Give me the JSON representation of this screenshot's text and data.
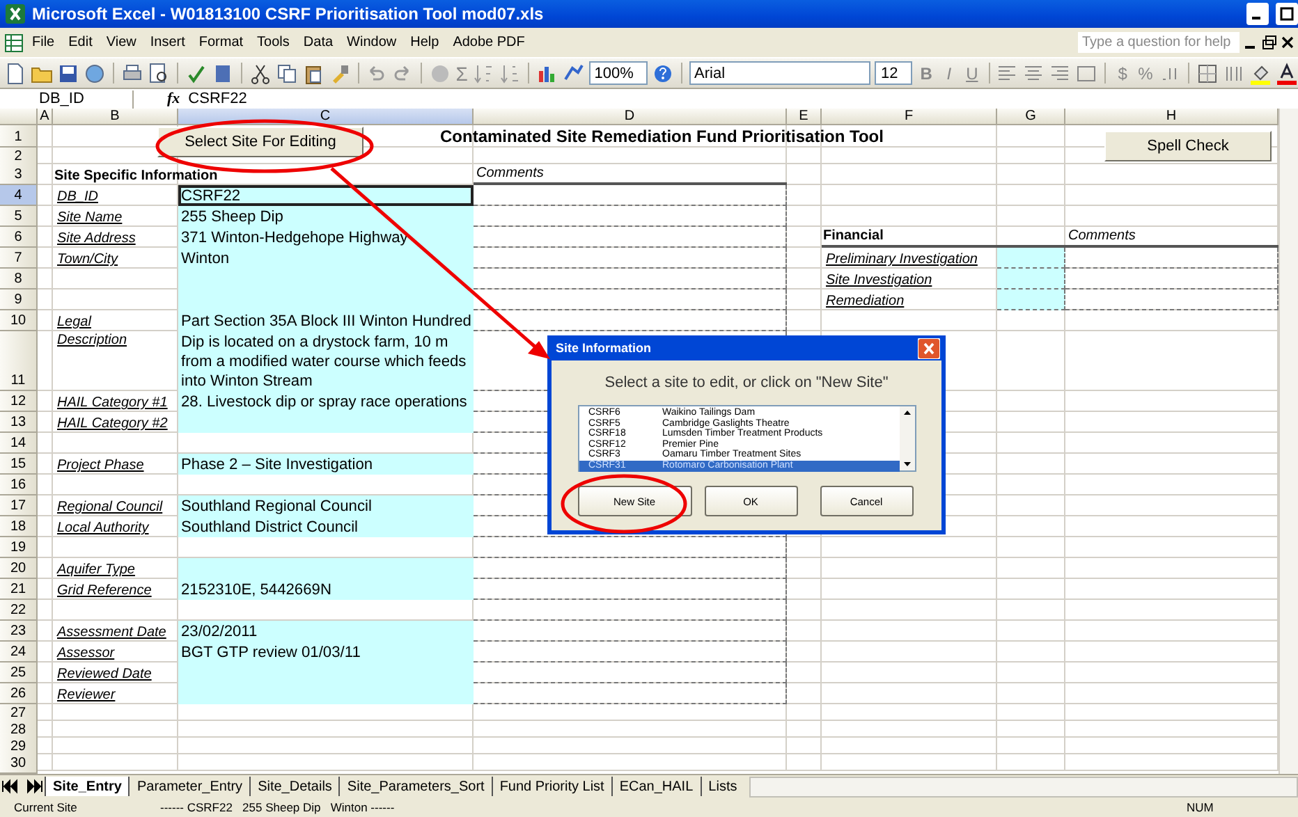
{
  "window": {
    "title": "Microsoft Excel - W01813100 CSRF Prioritisation Tool mod07.xls"
  },
  "menu": {
    "items": [
      "File",
      "Edit",
      "View",
      "Insert",
      "Format",
      "Tools",
      "Data",
      "Window",
      "Help",
      "Adobe PDF"
    ],
    "help_box": {
      "placeholder": "Type a question for help"
    }
  },
  "toolbar": {
    "sum": "Σ",
    "zoom": "100%",
    "font": "Arial",
    "size": "12",
    "format_buttons": [
      "B",
      "I",
      "U"
    ],
    "number_buttons": [
      "$",
      "%"
    ]
  },
  "formula_bar": {
    "name_box": "DB_ID",
    "fx": "fx",
    "value": "CSRF22"
  },
  "columns": [
    {
      "label": "A",
      "selected": false
    },
    {
      "label": "B",
      "selected": false
    },
    {
      "label": "C",
      "selected": true
    },
    {
      "label": "D",
      "selected": false
    },
    {
      "label": "E",
      "selected": false
    },
    {
      "label": "F",
      "selected": false
    },
    {
      "label": "G",
      "selected": false
    },
    {
      "label": "H",
      "selected": false
    }
  ],
  "sheet_buttons": {
    "select_site": "Select Site For Editing",
    "spell_check": "Spell Check"
  },
  "rows": [
    {
      "number": "1",
      "kind": "title",
      "title": "Contaminated Site Remediation Fund Prioritisation Tool",
      "selected": false
    },
    {
      "number": "2",
      "kind": "blank",
      "selected": false
    },
    {
      "number": "3",
      "kind": "heading",
      "label": "Site Specific Information",
      "comment": "Comments",
      "selected": false
    },
    {
      "number": "4",
      "kind": "data",
      "label": "DB_ID",
      "value": "CSRF22",
      "input": true,
      "selected": true
    },
    {
      "number": "5",
      "kind": "data",
      "label": "Site Name",
      "value": "255 Sheep Dip",
      "input": true,
      "selected": false
    },
    {
      "number": "6",
      "kind": "data",
      "label": "Site Address",
      "value": "371 Winton-Hedgehope Highway",
      "input": true,
      "selected": false,
      "right": {
        "kind": "heading",
        "label": "Financial",
        "comment": "Comments"
      }
    },
    {
      "number": "7",
      "kind": "data",
      "label": "Town/City",
      "value": "Winton",
      "input": true,
      "selected": false,
      "right": {
        "kind": "data",
        "label": "Preliminary Investigation",
        "input": true
      }
    },
    {
      "number": "8",
      "kind": "data",
      "input": true,
      "selected": false,
      "right": {
        "kind": "data",
        "label": "Site Investigation",
        "input": true
      }
    },
    {
      "number": "9",
      "kind": "data",
      "input": true,
      "selected": false,
      "right": {
        "kind": "data",
        "label": "Remediation",
        "input": true
      }
    },
    {
      "number": "10",
      "kind": "data",
      "label": "Legal",
      "value": "Part Section 35A Block III Winton Hundred",
      "input": true,
      "selected": false
    },
    {
      "number": "11",
      "kind": "data",
      "label": "Description",
      "value": "Dip is located on a drystock farm, 10 m from a modified water course which feeds into Winton Stream",
      "input": true,
      "selected": false
    },
    {
      "number": "12",
      "kind": "data",
      "label": "HAIL Category #1",
      "value": "28. Livestock dip or spray race operations",
      "input": true,
      "selected": false
    },
    {
      "number": "13",
      "kind": "data",
      "label": "HAIL Category #2",
      "input": true,
      "selected": false
    },
    {
      "number": "14",
      "kind": "data",
      "input": false,
      "selected": false
    },
    {
      "number": "15",
      "kind": "data",
      "label": "Project Phase",
      "value": "Phase 2 – Site Investigation",
      "input": true,
      "selected": false
    },
    {
      "number": "16",
      "kind": "data",
      "input": false,
      "selected": false
    },
    {
      "number": "17",
      "kind": "data",
      "label": "Regional Council",
      "value": "Southland Regional Council",
      "input": true,
      "selected": false
    },
    {
      "number": "18",
      "kind": "data",
      "label": "Local Authority",
      "value": "Southland District Council",
      "input": true,
      "selected": false
    },
    {
      "number": "19",
      "kind": "data",
      "input": false,
      "selected": false
    },
    {
      "number": "20",
      "kind": "data",
      "label": "Aquifer Type",
      "input": true,
      "selected": false
    },
    {
      "number": "21",
      "kind": "data",
      "label": "Grid Reference",
      "value": "2152310E, 5442669N",
      "input": true,
      "selected": false
    },
    {
      "number": "22",
      "kind": "data",
      "input": false,
      "selected": false
    },
    {
      "number": "23",
      "kind": "data",
      "label": "Assessment Date",
      "value": "23/02/2011",
      "input": true,
      "selected": false
    },
    {
      "number": "24",
      "kind": "data",
      "label": "Assessor",
      "value": "BGT  GTP review 01/03/11",
      "input": true,
      "selected": false
    },
    {
      "number": "25",
      "kind": "data",
      "label": "Reviewed Date",
      "input": true,
      "selected": false
    },
    {
      "number": "26",
      "kind": "data",
      "label": "Reviewer",
      "input": true,
      "selected": false
    },
    {
      "number": "27",
      "kind": "blank",
      "selected": false
    },
    {
      "number": "28",
      "kind": "blank",
      "selected": false
    },
    {
      "number": "29",
      "kind": "blank",
      "selected": false
    },
    {
      "number": "30",
      "kind": "blank",
      "selected": false
    }
  ],
  "dialog": {
    "title": "Site Information",
    "prompt": "Select a site to edit, or click on \"New Site\"",
    "items": [
      {
        "code": "CSRF6",
        "name": "Waikino Tailings Dam",
        "selected": false
      },
      {
        "code": "CSRF5",
        "name": "Cambridge Gaslights Theatre",
        "selected": false
      },
      {
        "code": "CSRF18",
        "name": "Lumsden Timber Treatment Products",
        "selected": false
      },
      {
        "code": "CSRF12",
        "name": "Premier Pine",
        "selected": false
      },
      {
        "code": "CSRF3",
        "name": "Oamaru Timber Treatment Sites",
        "selected": false
      },
      {
        "code": "CSRF31",
        "name": "Rotomaro Carbonisation Plant",
        "selected": true
      }
    ],
    "buttons": [
      "New Site",
      "OK",
      "Cancel"
    ]
  },
  "sheet_tabs": [
    {
      "label": "Site_Entry",
      "selected": true
    },
    {
      "label": "Parameter_Entry",
      "selected": false
    },
    {
      "label": "Site_Details",
      "selected": false
    },
    {
      "label": "Site_Parameters_Sort",
      "selected": false
    },
    {
      "label": "Fund Priority List",
      "selected": false
    },
    {
      "label": "ECan_HAIL",
      "selected": false
    },
    {
      "label": "Lists",
      "selected": false
    }
  ],
  "status_bar": {
    "label": "Current Site",
    "summary": "------ CSRF22   255 Sheep Dip   Winton ------",
    "mode": "NUM"
  }
}
